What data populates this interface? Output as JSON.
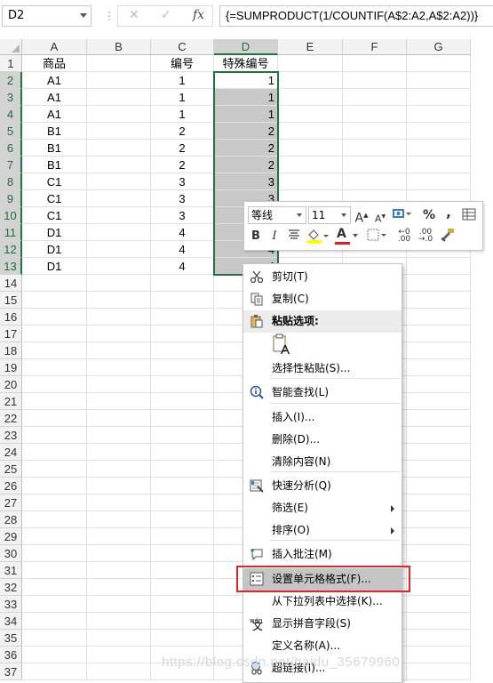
{
  "formula_bar": {
    "name_box": "D2",
    "cancel_icon": "✕",
    "enter_icon": "✓",
    "fx_label": "fx",
    "formula": "{=SUMPRODUCT(1/COUNTIF(A$2:A2,A$2:A2))}"
  },
  "sheet": {
    "columns": [
      "A",
      "B",
      "C",
      "D",
      "E",
      "F",
      "G"
    ],
    "rows": [
      "1",
      "2",
      "3",
      "4",
      "5",
      "6",
      "7",
      "8",
      "9",
      "10",
      "11",
      "12",
      "13",
      "14",
      "15",
      "16",
      "17",
      "18",
      "19",
      "20",
      "21",
      "22",
      "23",
      "24",
      "25",
      "26",
      "27",
      "28",
      "29",
      "30",
      "31",
      "32",
      "33",
      "34",
      "35",
      "36",
      "37"
    ],
    "header_row": {
      "A": "商品",
      "C": "编号",
      "D": "特殊编号"
    },
    "data": [
      {
        "A": "A1",
        "C": "1",
        "D": "1"
      },
      {
        "A": "A1",
        "C": "1",
        "D": "1"
      },
      {
        "A": "A1",
        "C": "1",
        "D": "1"
      },
      {
        "A": "B1",
        "C": "2",
        "D": "2"
      },
      {
        "A": "B1",
        "C": "2",
        "D": "2"
      },
      {
        "A": "B1",
        "C": "2",
        "D": "2"
      },
      {
        "A": "C1",
        "C": "3",
        "D": "3"
      },
      {
        "A": "C1",
        "C": "3",
        "D": "3"
      },
      {
        "A": "C1",
        "C": "3",
        "D": ""
      },
      {
        "A": "D1",
        "C": "4",
        "D": ""
      },
      {
        "A": "D1",
        "C": "4",
        "D": "4"
      },
      {
        "A": "D1",
        "C": "4",
        "D": "4"
      }
    ],
    "accent_color": "#217346"
  },
  "mini_toolbar": {
    "font_name": "等线",
    "font_size": "11",
    "grow_font": "A",
    "shrink_font": "A",
    "percent": "%",
    "comma": ",",
    "bold": "B",
    "italic": "I",
    "font_color": "A"
  },
  "context_menu": {
    "items": [
      {
        "label": "剪切(T)",
        "icon": "scissors-icon"
      },
      {
        "label": "复制(C)",
        "icon": "copy-icon"
      },
      {
        "label": "粘贴选项:",
        "icon": "paste-icon"
      },
      {
        "label": "选择性粘贴(S)...",
        "icon": ""
      },
      {
        "label": "智能查找(L)",
        "icon": "smart-lookup-icon"
      },
      {
        "label": "插入(I)...",
        "icon": ""
      },
      {
        "label": "删除(D)...",
        "icon": ""
      },
      {
        "label": "清除内容(N)",
        "icon": ""
      },
      {
        "label": "快速分析(Q)",
        "icon": "quick-analysis-icon"
      },
      {
        "label": "筛选(E)",
        "icon": ""
      },
      {
        "label": "排序(O)",
        "icon": ""
      },
      {
        "label": "插入批注(M)",
        "icon": "comment-icon"
      },
      {
        "label": "设置单元格格式(F)...",
        "icon": "format-cells-icon"
      },
      {
        "label": "从下拉列表中选择(K)...",
        "icon": ""
      },
      {
        "label": "显示拼音字段(S)",
        "icon": "phonetic-icon"
      },
      {
        "label": "定义名称(A)...",
        "icon": ""
      },
      {
        "label": "超链接(I)...",
        "icon": "hyperlink-icon"
      }
    ],
    "paste_option_glyph": "A",
    "phonetic_glyph": "wén"
  },
  "highlight_color": "#e02424",
  "watermark": "https://blog.csdn.net/baidu_35679960"
}
